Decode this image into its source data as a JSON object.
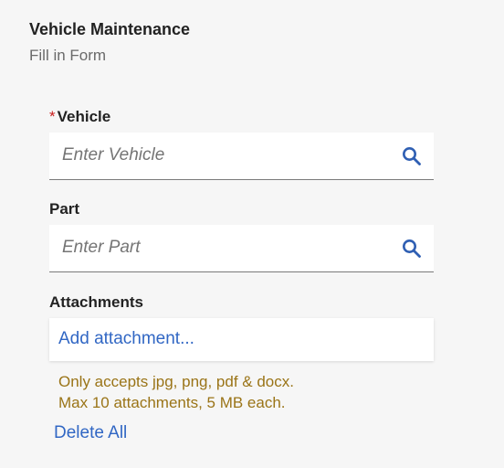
{
  "header": {
    "title": "Vehicle Maintenance",
    "subtitle": "Fill in Form"
  },
  "fields": {
    "vehicle": {
      "required_marker": "*",
      "label": "Vehicle",
      "placeholder": "Enter Vehicle",
      "value": "",
      "icon": "search-icon"
    },
    "part": {
      "label": "Part",
      "placeholder": "Enter Part",
      "value": "",
      "icon": "search-icon"
    }
  },
  "attachments": {
    "label": "Attachments",
    "add_link": "Add attachment...",
    "hint_types": "Only accepts jpg, png, pdf & docx.",
    "hint_limits": "Max 10 attachments, 5 MB each.",
    "delete_all": "Delete All"
  },
  "colors": {
    "background": "#f6f6f6",
    "link": "#3167c4",
    "required": "#c81c1c",
    "hint": "#9a7417",
    "icon": "#2f5fb3"
  }
}
